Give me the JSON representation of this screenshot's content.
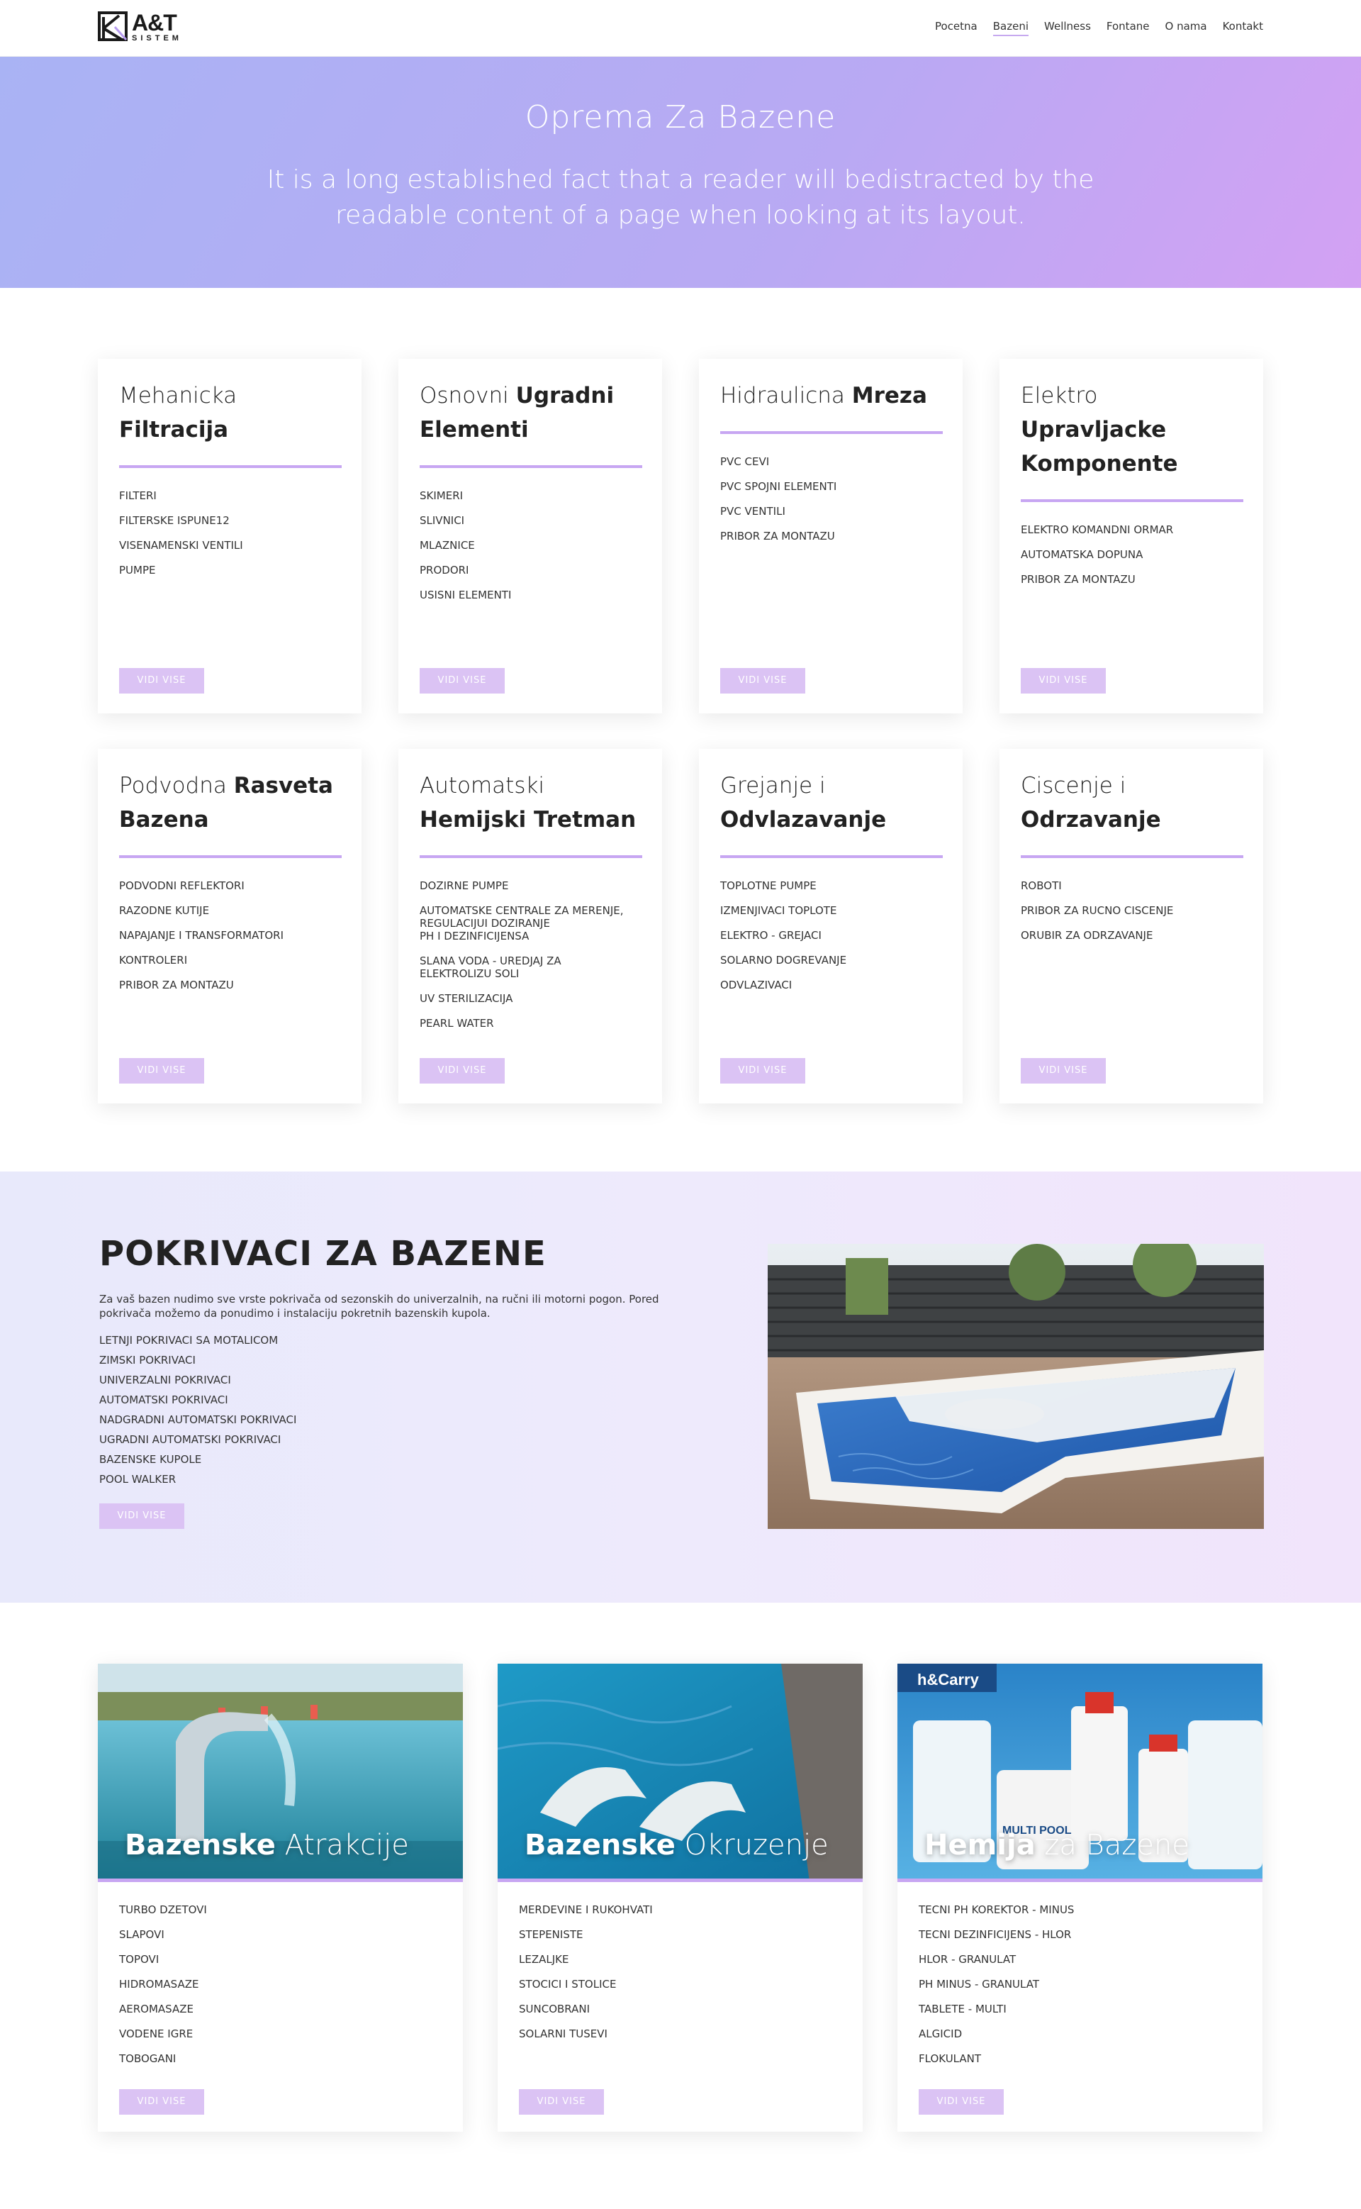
{
  "header": {
    "logo_title": "A&T",
    "logo_subtitle": "SISTEM",
    "nav": [
      {
        "label": "Pocetna"
      },
      {
        "label": "Bazeni",
        "active": true
      },
      {
        "label": "Wellness"
      },
      {
        "label": "Fontane"
      },
      {
        "label": "O nama"
      },
      {
        "label": "Kontakt"
      }
    ]
  },
  "hero": {
    "title": "Oprema Za Bazene",
    "subtitle": "It is a long established fact that a reader will bedistracted by the readable content of a page when looking at its layout."
  },
  "categories": [
    {
      "title_light": "Mehanicka",
      "title_bold": "Filtracija",
      "items": [
        "FILTERI",
        "FILTERSKE ISPUNE12",
        "VISENAMENSKI VENTILI",
        "PUMPE"
      ],
      "button": "VIDI VISE"
    },
    {
      "title_light": "Osnovni",
      "title_bold": "Ugradni Elementi",
      "items": [
        "SKIMERI",
        "SLIVNICI",
        "MLAZNICE",
        "PRODORI",
        "USISNI ELEMENTI"
      ],
      "button": "VIDI VISE"
    },
    {
      "title_light": "Hidraulicna",
      "title_bold": "Mreza",
      "items": [
        "PVC CEVI",
        "PVC SPOJNI ELEMENTI",
        "PVC VENTILI",
        "PRIBOR ZA MONTAZU"
      ],
      "button": "VIDI VISE"
    },
    {
      "title_light": "Elektro",
      "title_bold": "Upravljacke Komponente",
      "items": [
        "ELEKTRO KOMANDNI ORMAR",
        "AUTOMATSKA DOPUNA",
        "PRIBOR ZA MONTAZU"
      ],
      "button": "VIDI VISE"
    },
    {
      "title_light": "Podvodna",
      "title_bold": "Rasveta Bazena",
      "items": [
        "PODVODNI REFLEKTORI",
        "RAZODNE KUTIJE",
        "NAPAJANJE I TRANSFORMATORI",
        "KONTROLERI",
        "PRIBOR ZA MONTAZU"
      ],
      "button": "VIDI VISE"
    },
    {
      "title_light": "Automatski",
      "title_bold": "Hemijski Tretman",
      "items": [
        "DOZIRNE PUMPE",
        "AUTOMATSKE CENTRALE ZA MERENJE,\nREGULACIJUI DOZIRANJE\nPH I DEZINFICIJENSA",
        "SLANA VODA - UREDJAJ ZA\nELEKTROLIZU SOLI",
        "UV STERILIZACIJA",
        "PEARL WATER"
      ],
      "button": "VIDI VISE"
    },
    {
      "title_light": "Grejanje i",
      "title_bold": "Odvlazavanje",
      "items": [
        "TOPLOTNE PUMPE",
        "IZMENJIVACI TOPLOTE",
        "ELEKTRO - GREJACI",
        "SOLARNO DOGREVANJE",
        "ODVLAZIVACI"
      ],
      "button": "VIDI VISE"
    },
    {
      "title_light": "Ciscenje i",
      "title_bold": "Odrzavanje",
      "items": [
        "ROBOTI",
        "PRIBOR ZA RUCNO CISCENJE",
        "ORUBIR ZA ODRZAVANJE"
      ],
      "button": "VIDI VISE"
    }
  ],
  "covers": {
    "title": "POKRIVACI ZA BAZENE",
    "description": "Za vaš bazen nudimo sve vrste pokrivača od sezonskih do univerzalnih, na ručni ili motorni pogon. Pored pokrivača možemo da ponudimo i instalaciju pokretnih bazenskih kupola.",
    "items": [
      "LETNJI POKRIVACI SA MOTALICOM",
      "ZIMSKI POKRIVACI",
      "UNIVERZALNI POKRIVACI",
      "AUTOMATSKI POKRIVACI",
      "NADGRADNI AUTOMATSKI POKRIVACI",
      "UGRADNI AUTOMATSKI POKRIVACI",
      "BAZENSKE KUPOLE",
      "POOL WALKER"
    ],
    "button": "VIDI VISE"
  },
  "attractions": [
    {
      "title_bold": "Bazenske",
      "title_light": "Atrakcije",
      "items": [
        "TURBO DZETOVI",
        "SLAPOVI",
        "TOPOVI",
        "HIDROMASAZE",
        "AEROMASAZE",
        "VODENE IGRE",
        "TOBOGANI"
      ],
      "button": "VIDI VISE"
    },
    {
      "title_bold": "Bazenske",
      "title_light": "Okruzenje",
      "items": [
        "MERDEVINE I RUKOHVATI",
        "STEPENISTE",
        "LEZALJKE",
        "STOCICI I STOLICE",
        "SUNCOBRANI",
        "SOLARNI TUSEVI"
      ],
      "button": "VIDI VISE"
    },
    {
      "title_bold": "Hemija",
      "title_light": "za Bazene",
      "items": [
        "TECNI PH KOREKTOR - MINUS",
        "TECNI DEZINFICIJENS - HLOR",
        "HLOR - GRANULAT",
        "PH MINUS - GRANULAT",
        "TABLETE - MULTI",
        "ALGICID",
        "FLOKULANT"
      ],
      "button": "VIDI VISE",
      "image_text": {
        "store": "h&Carry",
        "product": "MULTI POOL"
      }
    }
  ]
}
